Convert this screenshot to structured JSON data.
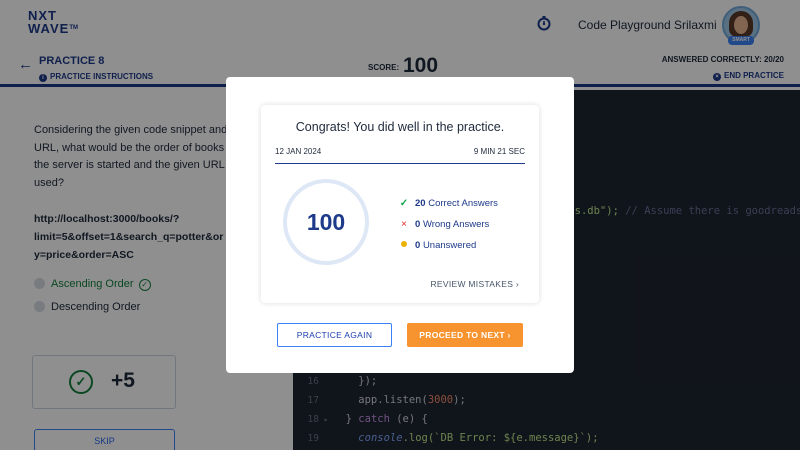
{
  "navbar": {
    "logo_line1": "NXT",
    "logo_line2": "WAVE",
    "logo_tm": "TM",
    "code_playground_label": "Code Playground",
    "user_name": "Srilaxmi",
    "avatar_badge": "SMART"
  },
  "header": {
    "back_icon": "←",
    "title": "PRACTICE 8",
    "instructions_label": "PRACTICE INSTRUCTIONS",
    "info_icon": "i",
    "score_label": "SCORE:",
    "score_value": "100",
    "answered_label": "ANSWERED CORRECTLY: 20/20",
    "end_icon": "×",
    "end_practice_label": "END PRACTICE"
  },
  "question": {
    "text_lines": [
      "Considering the given code snippet and",
      "URL, what would be the order of books",
      "the server is started and the given URL",
      "used?"
    ],
    "url_lines": [
      "http://localhost:3000/books/?",
      "limit=5&offset=1&search_q=potter&or",
      "y=price&order=ASC"
    ],
    "options": [
      {
        "label": "Ascending Order",
        "correct": true
      },
      {
        "label": "Descending Order",
        "correct": false
      }
    ],
    "correct_icon": "✓",
    "points_value": "+5",
    "skip_label": "SKIP"
  },
  "code": {
    "fragment_str": "ads.db\");",
    "fragment_comment": " // Assume there is goodreads",
    "lines": [
      {
        "num": "16",
        "marker": "",
        "text": "    });"
      },
      {
        "num": "17",
        "marker": "",
        "pre": "    app.listen(",
        "numlit": "3000",
        "post": ");"
      },
      {
        "num": "18",
        "marker": "▸",
        "pre": "  } ",
        "kw": "catch",
        "post": " (e) {"
      },
      {
        "num": "19",
        "marker": "",
        "pre": "    ",
        "fn": "console",
        "post": ".log(`DB Error: ${e.message}`);"
      }
    ]
  },
  "modal": {
    "congrats": "Congrats! You did well in the practice.",
    "date": "12 JAN 2024",
    "time": "9 MIN 21 SEC",
    "score": "100",
    "stats": [
      {
        "icon": "✓",
        "count": "20",
        "label": "Correct Answers"
      },
      {
        "icon": "×",
        "count": "0",
        "label": "Wrong Answers"
      },
      {
        "icon": "•",
        "count": "0",
        "label": "Unanswered"
      }
    ],
    "review_label": "REVIEW MISTAKES",
    "review_icon": "›",
    "practice_again_label": "PRACTICE AGAIN",
    "proceed_label": "PROCEED TO NEXT",
    "proceed_icon": "›"
  },
  "colors": {
    "brand_navy": "#1e3a8a",
    "accent_orange": "#f7942f",
    "success_green": "#16a34a",
    "error_red": "#dc2626",
    "warning_yellow": "#eab308",
    "code_background": "#1e2430"
  }
}
